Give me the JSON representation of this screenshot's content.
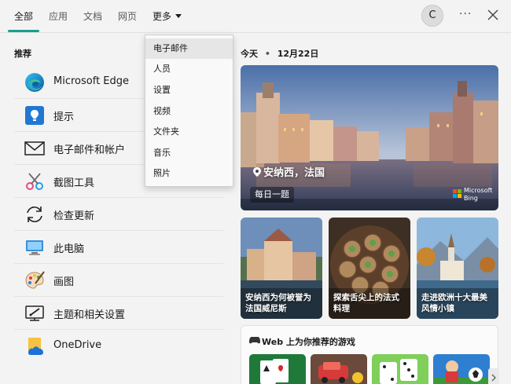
{
  "tabs": [
    {
      "label": "全部"
    },
    {
      "label": "应用"
    },
    {
      "label": "文档"
    },
    {
      "label": "网页"
    },
    {
      "label": "更多"
    }
  ],
  "account": {
    "initial": "C"
  },
  "window_controls": {
    "more": "···"
  },
  "left": {
    "section_title": "推荐",
    "apps": [
      {
        "label": "Microsoft Edge",
        "icon": "edge-icon"
      },
      {
        "label": "提示",
        "icon": "tips-icon"
      },
      {
        "label": "电子邮件和帐户",
        "icon": "mail-icon"
      },
      {
        "label": "截图工具",
        "icon": "snipping-tool-icon"
      },
      {
        "label": "检查更新",
        "icon": "update-icon"
      },
      {
        "label": "此电脑",
        "icon": "computer-icon"
      },
      {
        "label": "画图",
        "icon": "paint-icon"
      },
      {
        "label": "主题和相关设置",
        "icon": "theme-icon"
      },
      {
        "label": "OneDrive",
        "icon": "onedrive-icon"
      }
    ]
  },
  "dropdown": {
    "items": [
      {
        "label": "电子邮件",
        "selected": true
      },
      {
        "label": "人员"
      },
      {
        "label": "设置"
      },
      {
        "label": "视频"
      },
      {
        "label": "文件夹"
      },
      {
        "label": "音乐"
      },
      {
        "label": "照片"
      }
    ]
  },
  "right": {
    "today_label": "今天",
    "date": "12月22日",
    "hero": {
      "location": "安纳西，法国",
      "badge": "每日一题",
      "brand_line1": "Microsoft",
      "brand_line2": "Bing"
    },
    "tiles": [
      {
        "caption": "安纳西为何被誉为法国威尼斯"
      },
      {
        "caption": "探索舌尖上的法式料理"
      },
      {
        "caption": "走进欧洲十大最美风情小镇"
      }
    ],
    "games": {
      "title": "Web 上为你推荐的游戏"
    }
  },
  "colors": {
    "accent": "#1a9e8e",
    "background": "#f3f3f3"
  }
}
